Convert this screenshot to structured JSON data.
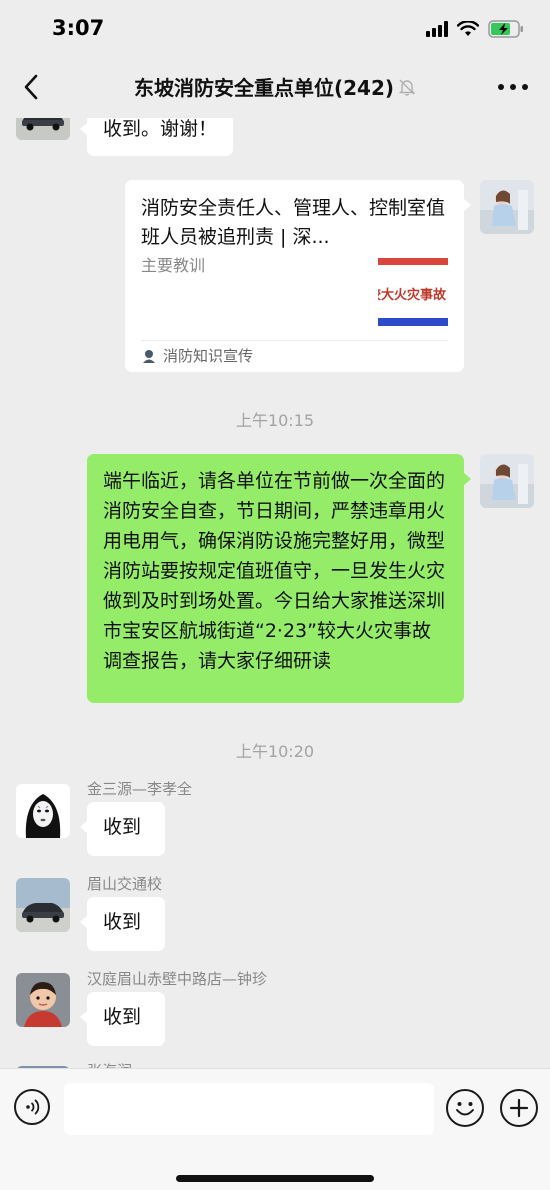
{
  "status_bar": {
    "time": "3:07"
  },
  "nav": {
    "title": "东坡消防安全重点单位(242)"
  },
  "messages": {
    "m0_text": "收到。谢谢！",
    "card": {
      "title": "消防安全责任人、管理人、控制室值班人员被追刑责 | 深...",
      "description": "主要教训",
      "thumb_text": "较大火灾事故",
      "source": "消防知识宣传"
    },
    "time1": "上午10:15",
    "long_text": "端午临近，请各单位在节前做一次全面的消防安全自查，节日期间，严禁违章用火用电用气，确保消防设施完整好用，微型消防站要按规定值班值守，一旦发生火灾做到及时到场处置。今日给大家推送深圳市宝安区航城街道“2·23”较大火灾事故调查报告，请大家仔细研读",
    "time2": "上午10:20",
    "group": [
      {
        "sender": "金三源—李孝全",
        "text": "收到"
      },
      {
        "sender": "眉山交通校",
        "text": "收到"
      },
      {
        "sender": "汉庭眉山赤壁中路店—钟珍",
        "text": "收到"
      },
      {
        "sender": "张海润"
      }
    ]
  },
  "input": {
    "placeholder": ""
  },
  "icons": {
    "back": "chevron-left-icon",
    "mute": "bell-off-icon",
    "more": "more-horizontal-icon",
    "voice": "voice-icon",
    "emoji": "emoji-icon",
    "plus": "plus-icon"
  },
  "colors": {
    "self_bubble": "#95ec69",
    "background": "#ededed"
  }
}
